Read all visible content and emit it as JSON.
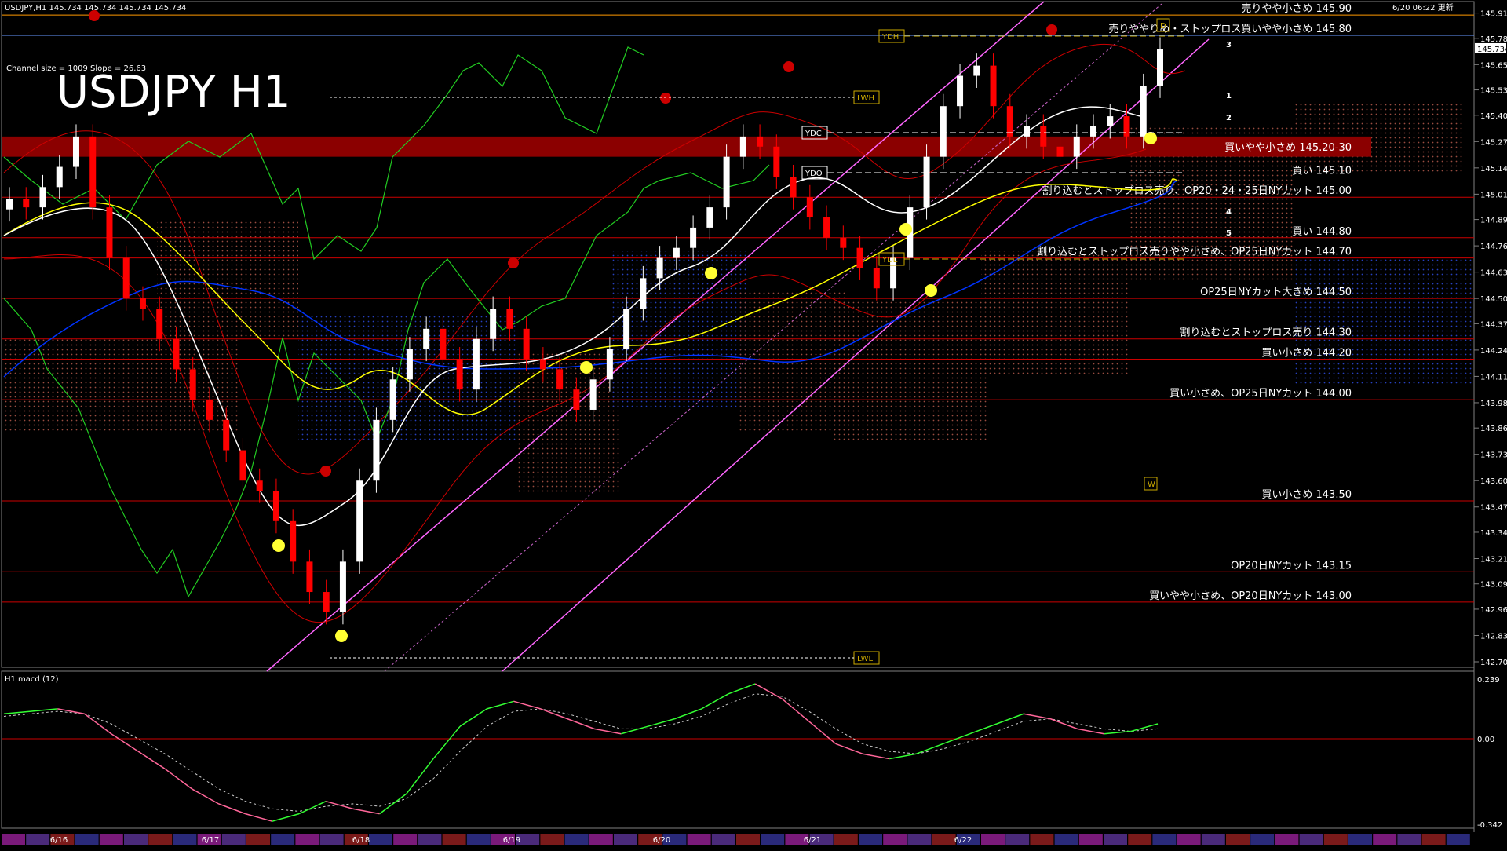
{
  "header": {
    "symbol_info": "USDJPY,H1  145.734 145.734 145.734 145.734",
    "timestamp": "6/20 06:22 更新",
    "channel_info": "Channel size = 1009 Slope = 26.63",
    "title": "USDJPY H1"
  },
  "chart_data": [
    {
      "type": "line",
      "title": "USDJPY H1",
      "subtitle": "Channel size = 1009 Slope = 26.63",
      "ylim": [
        142.705,
        145.92
      ],
      "yticks": [
        "145.910",
        "145.785",
        "145.655",
        "145.530",
        "145.405",
        "145.275",
        "145.145",
        "145.015",
        "144.890",
        "144.760",
        "144.630",
        "144.500",
        "144.375",
        "144.245",
        "144.115",
        "143.985",
        "143.860",
        "143.730",
        "143.600",
        "143.470",
        "143.345",
        "143.215",
        "143.090",
        "142.965",
        "142.835",
        "142.705"
      ],
      "current_price": "145.734",
      "date_labels": [
        "6/16",
        "6/17",
        "6/18",
        "6/19",
        "6/20",
        "6/21",
        "6/22"
      ],
      "close_series": [
        144.99,
        144.95,
        145.05,
        145.15,
        145.3,
        144.95,
        144.7,
        144.5,
        144.45,
        144.3,
        144.15,
        144.0,
        143.9,
        143.75,
        143.6,
        143.55,
        143.4,
        143.2,
        143.05,
        142.95,
        143.2,
        143.6,
        143.9,
        144.1,
        144.25,
        144.35,
        144.2,
        144.05,
        144.3,
        144.45,
        144.35,
        144.2,
        144.15,
        144.05,
        143.95,
        144.1,
        144.25,
        144.45,
        144.6,
        144.7,
        144.75,
        144.85,
        144.95,
        145.2,
        145.3,
        145.25,
        145.1,
        145.0,
        144.9,
        144.8,
        144.75,
        144.65,
        144.55,
        144.7,
        144.95,
        145.2,
        145.45,
        145.6,
        145.65,
        145.45,
        145.3,
        145.35,
        145.25,
        145.2,
        145.3,
        145.35,
        145.4,
        145.3,
        145.55,
        145.73
      ],
      "levels": [
        {
          "price": "145.90",
          "label": "売りやや小さめ 145.90",
          "color": "#ff9900"
        },
        {
          "price": "145.80",
          "label": "売りややりめ・ストップロス買いやや小さめ 145.80",
          "color": "#6699ff"
        },
        {
          "price": "145.20-30",
          "label": "買いやや小さめ 145.20-30",
          "color": "#990000"
        },
        {
          "price": "145.10",
          "label": "買い 145.10",
          "color": "#cc0000"
        },
        {
          "price": "145.00",
          "label": "割り込むとストップロス売り、OP20・24・25日NYカット 145.00",
          "color": "#cc0000"
        },
        {
          "price": "144.80",
          "label": "買い 144.80",
          "color": "#cc0000"
        },
        {
          "price": "144.70",
          "label": "割り込むとストップロス売りやや小さめ、OP25日NYカット 144.70",
          "color": "#cc0000"
        },
        {
          "price": "144.50",
          "label": "OP25日NYカット大きめ 144.50",
          "color": "#cc0000"
        },
        {
          "price": "144.30",
          "label": "割り込むとストップロス売り 144.30",
          "color": "#cc0000"
        },
        {
          "price": "144.20",
          "label": "買い小さめ 144.20",
          "color": "#cc0000"
        },
        {
          "price": "144.00",
          "label": "買い小さめ、OP25日NYカット 144.00",
          "color": "#cc0000"
        },
        {
          "price": "143.50",
          "label": "買い小さめ 143.50",
          "color": "#cc0000"
        },
        {
          "price": "143.15",
          "label": "OP20日NYカット 143.15",
          "color": "#cc0000"
        },
        {
          "price": "143.00",
          "label": "買いやや小さめ、OP20日NYカット 143.00",
          "color": "#cc0000"
        }
      ],
      "markers": [
        "YDH",
        "LWH",
        "YDC",
        "YDO",
        "YDL",
        "LWL",
        "D",
        "W",
        "3",
        "1",
        "2",
        "4",
        "5"
      ]
    },
    {
      "type": "line",
      "title": "H1  macd (12)",
      "yticks": [
        "0.239",
        "0.00",
        "-0.342"
      ],
      "ylim": [
        -0.342,
        0.239
      ],
      "macd": [
        0.1,
        0.11,
        0.12,
        0.1,
        0.02,
        -0.05,
        -0.12,
        -0.2,
        -0.26,
        -0.3,
        -0.33,
        -0.3,
        -0.25,
        -0.28,
        -0.3,
        -0.22,
        -0.08,
        0.05,
        0.12,
        0.15,
        0.12,
        0.08,
        0.04,
        0.02,
        0.05,
        0.08,
        0.12,
        0.18,
        0.22,
        0.16,
        0.07,
        -0.02,
        -0.06,
        -0.08,
        -0.06,
        -0.02,
        0.02,
        0.06,
        0.1,
        0.08,
        0.04,
        0.02,
        0.03,
        0.06
      ],
      "signal": [
        0.09,
        0.1,
        0.11,
        0.1,
        0.06,
        0.0,
        -0.06,
        -0.13,
        -0.2,
        -0.25,
        -0.28,
        -0.29,
        -0.27,
        -0.26,
        -0.27,
        -0.24,
        -0.16,
        -0.05,
        0.05,
        0.11,
        0.12,
        0.1,
        0.07,
        0.04,
        0.04,
        0.06,
        0.09,
        0.14,
        0.18,
        0.17,
        0.11,
        0.04,
        -0.02,
        -0.05,
        -0.06,
        -0.04,
        -0.01,
        0.03,
        0.07,
        0.08,
        0.06,
        0.04,
        0.03,
        0.04
      ]
    }
  ],
  "colors": {
    "background": "#000000",
    "bull": "#ffffff",
    "bear": "#ff0000",
    "ma_short": "#ffffff",
    "ma_mid": "#ffff00",
    "ma_long": "#0033ff",
    "channel": "#ff66ff",
    "macd_up": "#33ff33",
    "macd_down": "#ff6699"
  }
}
